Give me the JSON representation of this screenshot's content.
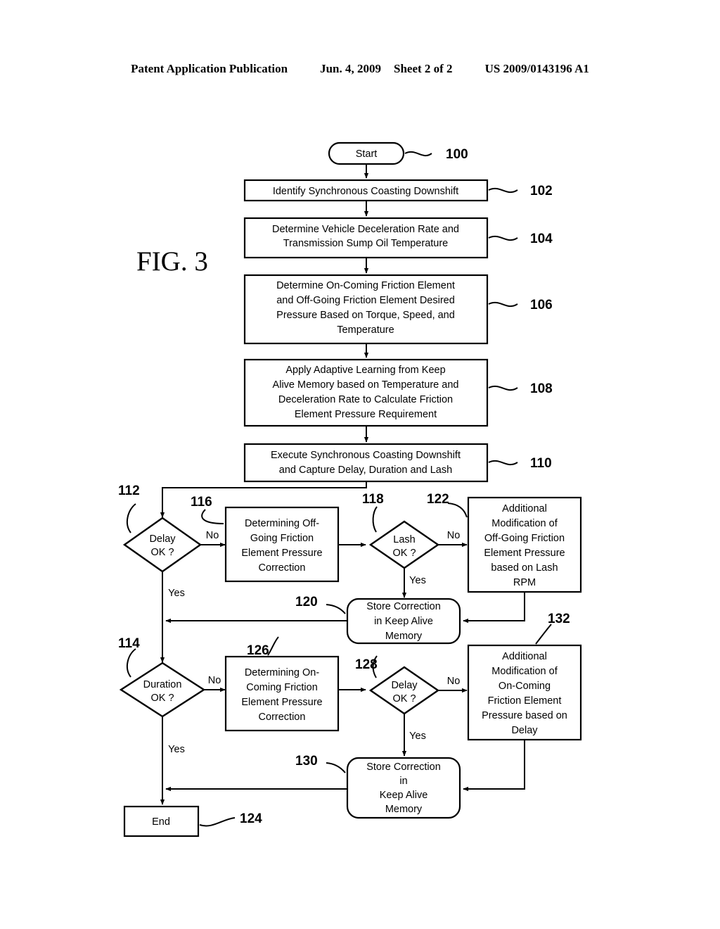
{
  "header": {
    "publication": "Patent Application Publication",
    "date": "Jun. 4, 2009",
    "sheet": "Sheet 2 of 2",
    "number": "US 2009/0143196 A1"
  },
  "figure": {
    "label": "FIG. 3"
  },
  "nodes": {
    "start": {
      "ref": "100",
      "text": "Start"
    },
    "n102": {
      "ref": "102",
      "lines": [
        "Identify Synchronous Coasting Downshift"
      ]
    },
    "n104": {
      "ref": "104",
      "lines": [
        "Determine Vehicle Deceleration Rate and",
        "Transmission Sump Oil Temperature"
      ]
    },
    "n106": {
      "ref": "106",
      "lines": [
        "Determine On-Coming Friction Element",
        "and Off-Going Friction Element Desired",
        "Pressure Based on Torque, Speed, and",
        "Temperature"
      ]
    },
    "n108": {
      "ref": "108",
      "lines": [
        "Apply Adaptive Learning from Keep",
        "Alive Memory based on Temperature and",
        "Deceleration Rate to Calculate Friction",
        "Element Pressure Requirement"
      ]
    },
    "n110": {
      "ref": "110",
      "lines": [
        "Execute Synchronous Coasting Downshift",
        "and Capture Delay, Duration and Lash"
      ]
    },
    "n112": {
      "ref": "112",
      "lines": [
        "Delay",
        "OK ?"
      ]
    },
    "n114": {
      "ref": "114",
      "lines": [
        "Duration",
        "OK ?"
      ]
    },
    "n116": {
      "ref": "116",
      "lines": [
        "Determining Off-",
        "Going Friction",
        "Element Pressure",
        "Correction"
      ]
    },
    "n118": {
      "ref": "118",
      "lines": [
        "Lash",
        "OK ?"
      ]
    },
    "n120": {
      "ref": "120",
      "lines": [
        "Store Correction",
        "in Keep Alive",
        "Memory"
      ]
    },
    "n122": {
      "ref": "122",
      "lines": [
        "Additional",
        "Modification of",
        "Off-Going Friction",
        "Element Pressure",
        "based on Lash",
        "RPM"
      ]
    },
    "n124": {
      "ref": "124",
      "text": "End"
    },
    "n126": {
      "ref": "126",
      "lines": [
        "Determining On-",
        "Coming Friction",
        "Element Pressure",
        "Correction"
      ]
    },
    "n128": {
      "ref": "128",
      "lines": [
        "Delay",
        "OK ?"
      ]
    },
    "n130": {
      "ref": "130",
      "lines": [
        "Store Correction",
        "in",
        "Keep Alive",
        "Memory"
      ]
    },
    "n132": {
      "ref": "132",
      "lines": [
        "Additional",
        "Modification of",
        "On-Coming",
        "Friction Element",
        "Pressure based on",
        "Delay"
      ]
    }
  },
  "edge_labels": {
    "no_112": "No",
    "yes_112": "Yes",
    "no_118": "No",
    "yes_118": "Yes",
    "no_114": "No",
    "yes_114": "Yes",
    "no_128": "No",
    "yes_128": "Yes"
  },
  "colors": {
    "ink": "#000000",
    "paper": "#ffffff"
  }
}
